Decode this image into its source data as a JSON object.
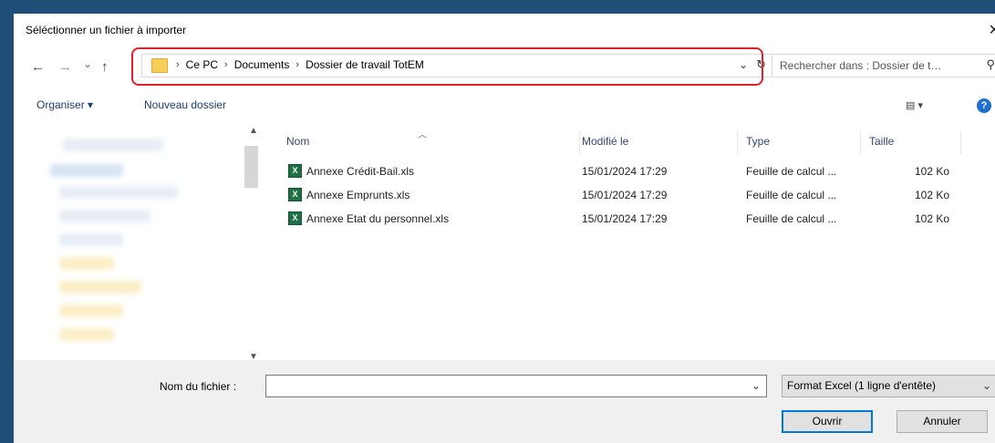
{
  "dialog": {
    "title": "Séléctionner un fichier à importer",
    "close_icon": "close-icon"
  },
  "navigation": {
    "back": "←",
    "forward": "→",
    "recent": "⌄",
    "up": "↑",
    "breadcrumbs": [
      "Ce PC",
      "Documents",
      "Dossier de travail TotEM"
    ],
    "separator": "›",
    "refresh": "↻"
  },
  "search": {
    "placeholder": "Rechercher dans : Dossier de t…",
    "icon": "search-icon"
  },
  "toolbar": {
    "organize_label": "Organiser ▾",
    "new_folder_label": "Nouveau dossier",
    "view_icon": "view-options-icon",
    "help_icon": "help-icon",
    "help_glyph": "?"
  },
  "columns": {
    "name": "Nom",
    "modified": "Modifié le",
    "type": "Type",
    "size": "Taille"
  },
  "files": [
    {
      "name": "Annexe Crédit-Bail.xls",
      "modified": "15/01/2024 17:29",
      "type": "Feuille de calcul ...",
      "size": "102 Ko"
    },
    {
      "name": "Annexe Emprunts.xls",
      "modified": "15/01/2024 17:29",
      "type": "Feuille de calcul ...",
      "size": "102 Ko"
    },
    {
      "name": "Annexe Etat du personnel.xls",
      "modified": "15/01/2024 17:29",
      "type": "Feuille de calcul ...",
      "size": "102 Ko"
    }
  ],
  "footer": {
    "filename_label": "Nom du fichier :",
    "filename_value": "",
    "format_selected": "Format Excel (1 ligne d'entête)",
    "open_label": "Ouvrir",
    "cancel_label": "Annuler"
  },
  "colors": {
    "background": "#1f4e79",
    "highlight_border": "#e0202a",
    "excel_icon": "#1e7145",
    "primary_button_border": "#0078d7"
  }
}
